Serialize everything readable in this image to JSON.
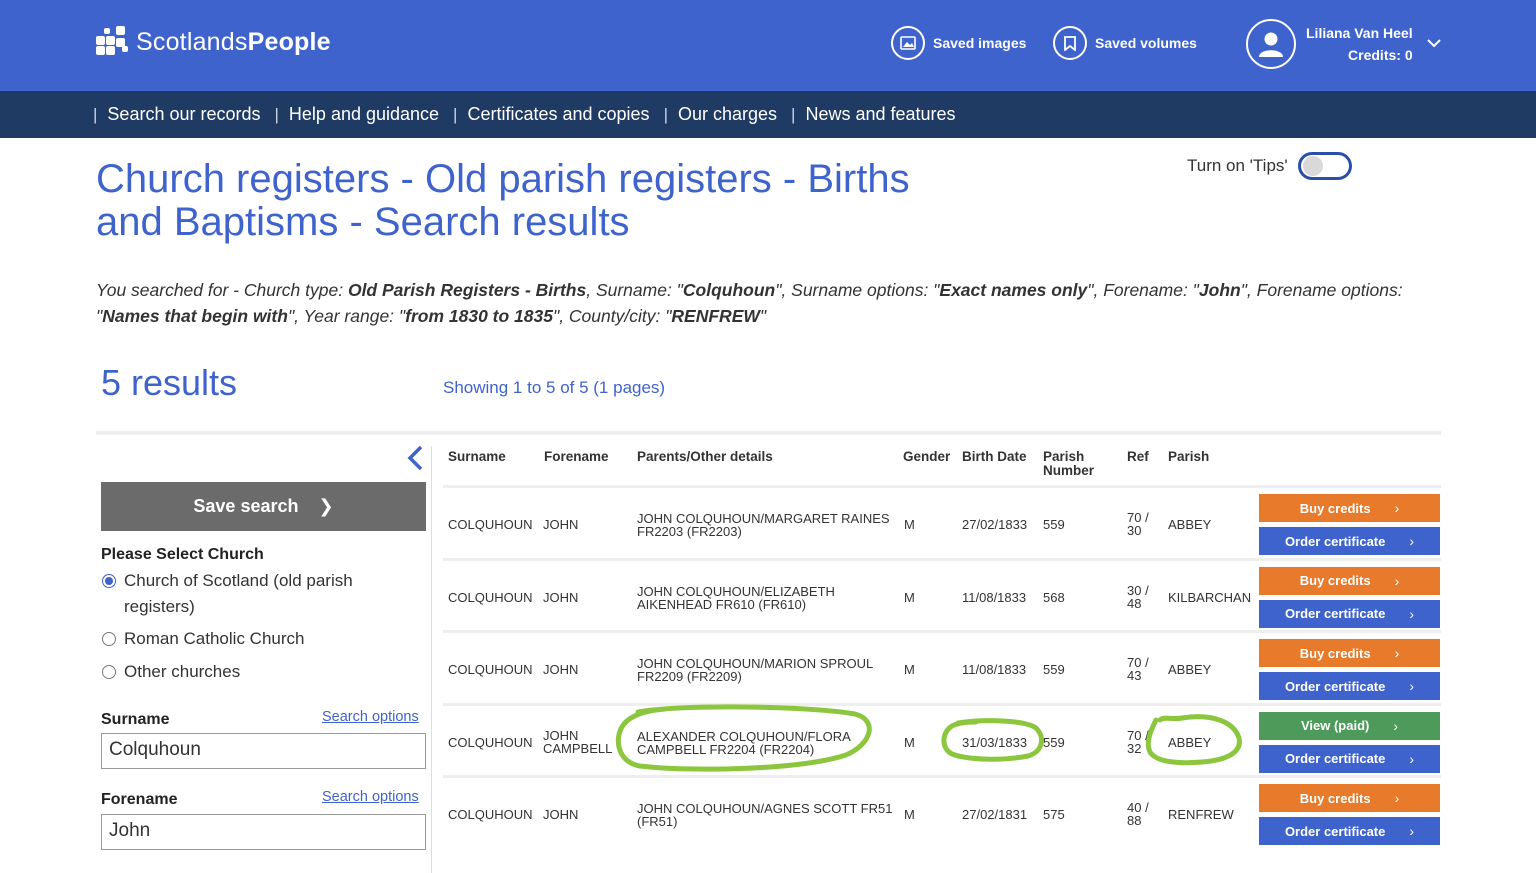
{
  "brand": {
    "logo_light": "Scotlands",
    "logo_bold": "People"
  },
  "header": {
    "saved_images": "Saved images",
    "saved_volumes": "Saved volumes",
    "user_name": "Liliana Van Heel",
    "credits": "Credits: 0"
  },
  "nav": {
    "items": [
      "Search our records",
      "Help and guidance",
      "Certificates and copies",
      "Our charges",
      "News and features"
    ]
  },
  "title": {
    "line1": "Church registers - Old parish registers - Births",
    "line2": "and Baptisms - Search results"
  },
  "tips": {
    "label": "Turn on 'Tips'",
    "enabled": false
  },
  "search_summary": {
    "prefix": "You searched for - Church type: ",
    "church_type": "Old Parish Registers - Births",
    "surname_label": ", Surname: \"",
    "surname": "Colquhoun",
    "surname_opts_label": "\", Surname options: \"",
    "surname_opts": "Exact names only",
    "forename_label": "\", Forename: \"",
    "forename": "John",
    "forename_opts_label": "\", Forename options: \"",
    "forename_opts": "Names that begin with",
    "year_label": "\", Year range: \"",
    "year": "from 1830 to 1835",
    "county_label": "\", County/city: \"",
    "county": "RENFREW",
    "suffix": "\""
  },
  "results": {
    "count_label": "5 results",
    "showing": "Showing 1 to 5 of 5 (1 pages)"
  },
  "sidebar": {
    "save_search": "Save search",
    "church_heading": "Please Select Church",
    "church_options": [
      {
        "line1": "Church of Scotland (old parish",
        "line2": "registers)",
        "selected": true
      },
      {
        "line1": "Roman Catholic Church",
        "line2": "",
        "selected": false
      },
      {
        "line1": "Other churches",
        "line2": "",
        "selected": false
      }
    ],
    "surname_label": "Surname",
    "surname_value": "Colquhoun",
    "forename_label": "Forename",
    "forename_value": "John",
    "search_options": "Search options"
  },
  "table": {
    "headers": {
      "surname": "Surname",
      "forename": "Forename",
      "parents": "Parents/Other details",
      "gender": "Gender",
      "birth_date": "Birth Date",
      "parish_number_1": "Parish",
      "parish_number_2": "Number",
      "ref": "Ref",
      "parish": "Parish"
    },
    "rows": [
      {
        "surname": "COLQUHOUN",
        "forename1": "JOHN",
        "forename2": "",
        "parents1": "JOHN COLQUHOUN/MARGARET RAINES",
        "parents2": "FR2203 (FR2203)",
        "gender": "M",
        "birth_date": "27/02/1833",
        "parish_number": "559",
        "ref1": "70 /",
        "ref2": "30",
        "parish": "ABBEY",
        "btn1": "Buy credits",
        "btn1_color": "orange",
        "btn2": "Order certificate"
      },
      {
        "surname": "COLQUHOUN",
        "forename1": "JOHN",
        "forename2": "",
        "parents1": "JOHN COLQUHOUN/ELIZABETH",
        "parents2": "AIKENHEAD FR610 (FR610)",
        "gender": "M",
        "birth_date": "11/08/1833",
        "parish_number": "568",
        "ref1": "30 /",
        "ref2": "48",
        "parish": "KILBARCHAN",
        "btn1": "Buy credits",
        "btn1_color": "orange",
        "btn2": "Order certificate"
      },
      {
        "surname": "COLQUHOUN",
        "forename1": "JOHN",
        "forename2": "",
        "parents1": "JOHN COLQUHOUN/MARION SPROUL",
        "parents2": "FR2209 (FR2209)",
        "gender": "M",
        "birth_date": "11/08/1833",
        "parish_number": "559",
        "ref1": "70 /",
        "ref2": "43",
        "parish": "ABBEY",
        "btn1": "Buy credits",
        "btn1_color": "orange",
        "btn2": "Order certificate"
      },
      {
        "surname": "COLQUHOUN",
        "forename1": "JOHN",
        "forename2": "CAMPBELL",
        "parents1": "ALEXANDER COLQUHOUN/FLORA",
        "parents2": "CAMPBELL FR2204 (FR2204)",
        "gender": "M",
        "birth_date": "31/03/1833",
        "parish_number": "559",
        "ref1": "70 /",
        "ref2": "32",
        "parish": "ABBEY",
        "btn1": "View (paid)",
        "btn1_color": "green",
        "btn2": "Order certificate"
      },
      {
        "surname": "COLQUHOUN",
        "forename1": "JOHN",
        "forename2": "",
        "parents1": "JOHN COLQUHOUN/AGNES SCOTT FR51",
        "parents2": "(FR51)",
        "gender": "M",
        "birth_date": "27/02/1831",
        "parish_number": "575",
        "ref1": "40 /",
        "ref2": "88",
        "parish": "RENFREW",
        "btn1": "Buy credits",
        "btn1_color": "orange",
        "btn2": "Order certificate"
      }
    ]
  },
  "colors": {
    "brand_blue": "#3f63cc",
    "nav_navy": "#1f3a63",
    "orange": "#e87a2b",
    "green": "#4e9a5a",
    "annotation": "#8cc63f"
  }
}
